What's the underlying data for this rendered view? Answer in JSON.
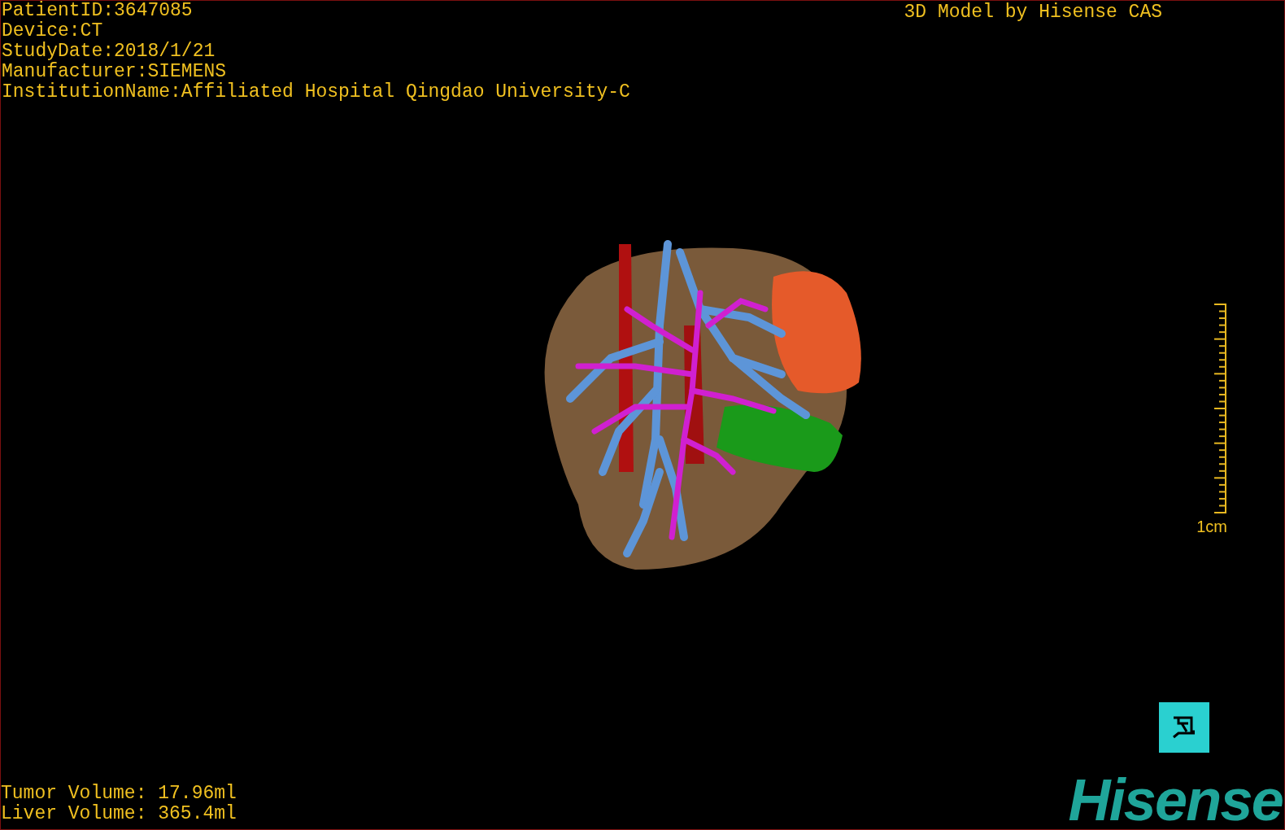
{
  "study_info": [
    "PatientID:3647085",
    "Device:CT",
    "StudyDate:2018/1/21",
    "Manufacturer:SIEMENS",
    "InstitutionName:Affiliated Hospital Qingdao University-C"
  ],
  "title": "3D Model by Hisense CAS",
  "scale_bar": {
    "label": "1cm"
  },
  "volumes": [
    "Tumor Volume: 17.96ml",
    "Liver Volume: 365.4ml"
  ],
  "logo": "Hisense"
}
